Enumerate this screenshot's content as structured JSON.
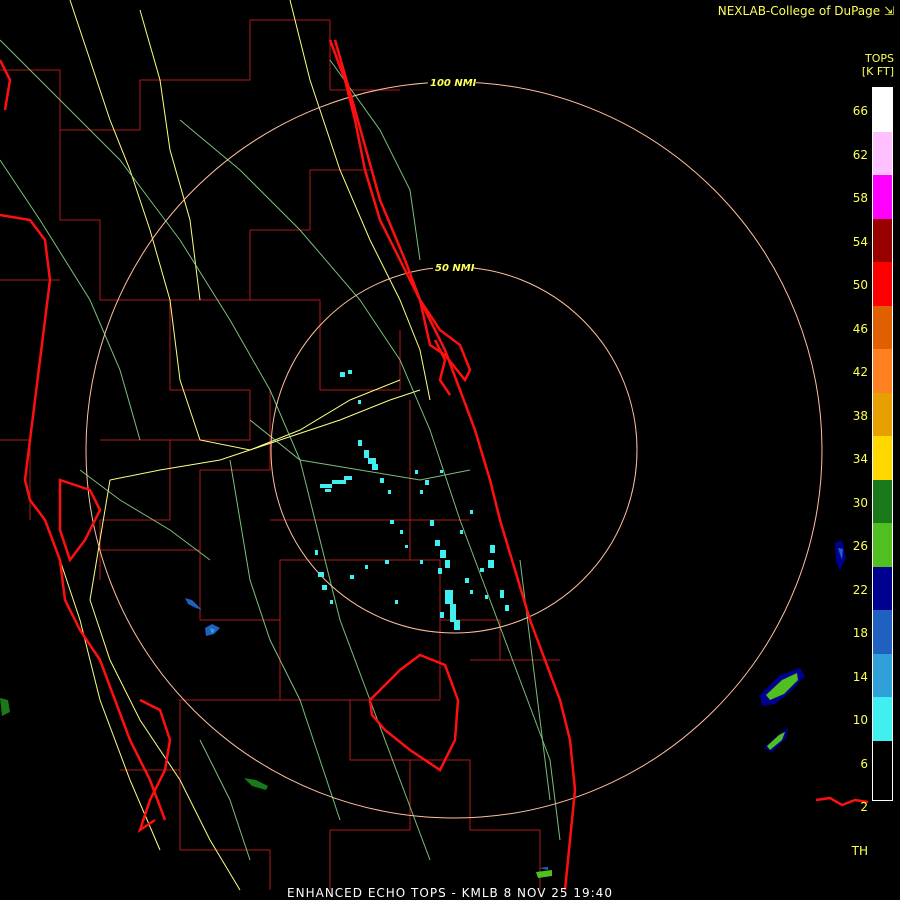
{
  "header": {
    "credit": "NEXLAB-College of DuPage ⇲"
  },
  "legend": {
    "title_line1": "TOPS",
    "title_line2": "[K FT]",
    "labels": [
      "66",
      "62",
      "58",
      "54",
      "50",
      "46",
      "42",
      "38",
      "34",
      "30",
      "26",
      "22",
      "18",
      "14",
      "10",
      "6",
      "2",
      "TH"
    ],
    "colors": [
      "#ffffff",
      "#ffc0ff",
      "#ff00ff",
      "#990000",
      "#ff0000",
      "#e06000",
      "#ff8020",
      "#e8a000",
      "#ffd800",
      "#1a7a1a",
      "#50c020",
      "#000090",
      "#2060c0",
      "#30a0d8",
      "#40f0f0"
    ]
  },
  "rings": {
    "inner_label": "50 NMI",
    "outer_label": "100 NMI"
  },
  "footer": {
    "caption": "ENHANCED ECHO TOPS - KMLB 8 NOV 25 19:40"
  },
  "colors": {
    "state_border": "#ff0000",
    "county": "#c02020",
    "roads_yellow": "#ffff80",
    "roads_green": "#a0f0a0",
    "ring": "#ffc0a0",
    "echo_cyan": "#40f0f0"
  }
}
